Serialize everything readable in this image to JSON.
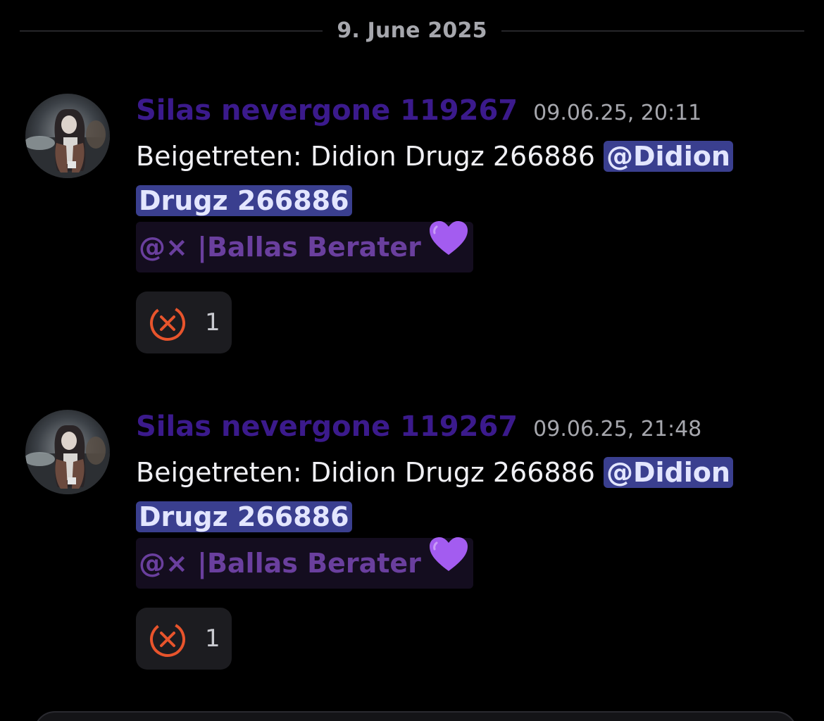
{
  "divider": {
    "date": "9. June 2025"
  },
  "messages": [
    {
      "author": "Silas nevergone 119267",
      "timestamp": "09.06.25, 20:11",
      "text": "Beigetreten: Didion Drugz 266886 ",
      "mention": "@Didion Drugz 266886",
      "role_mention": "@× |Ballas Berater",
      "reaction": {
        "icon": "cross-mark-emoji",
        "count": "1"
      }
    },
    {
      "author": "Silas nevergone 119267",
      "timestamp": "09.06.25, 21:48",
      "text": "Beigetreten: Didion Drugz 266886 ",
      "mention": "@Didion Drugz 266886",
      "role_mention": "@× |Ballas Berater",
      "reaction": {
        "icon": "cross-mark-emoji",
        "count": "1"
      }
    }
  ],
  "colors": {
    "background": "#000000",
    "author": "#3b1a8c",
    "mention_bg": "#3a3f8f",
    "role_mention": "#6a3f9e",
    "heart": "#a35cf0",
    "reaction_icon": "#e8542c"
  }
}
